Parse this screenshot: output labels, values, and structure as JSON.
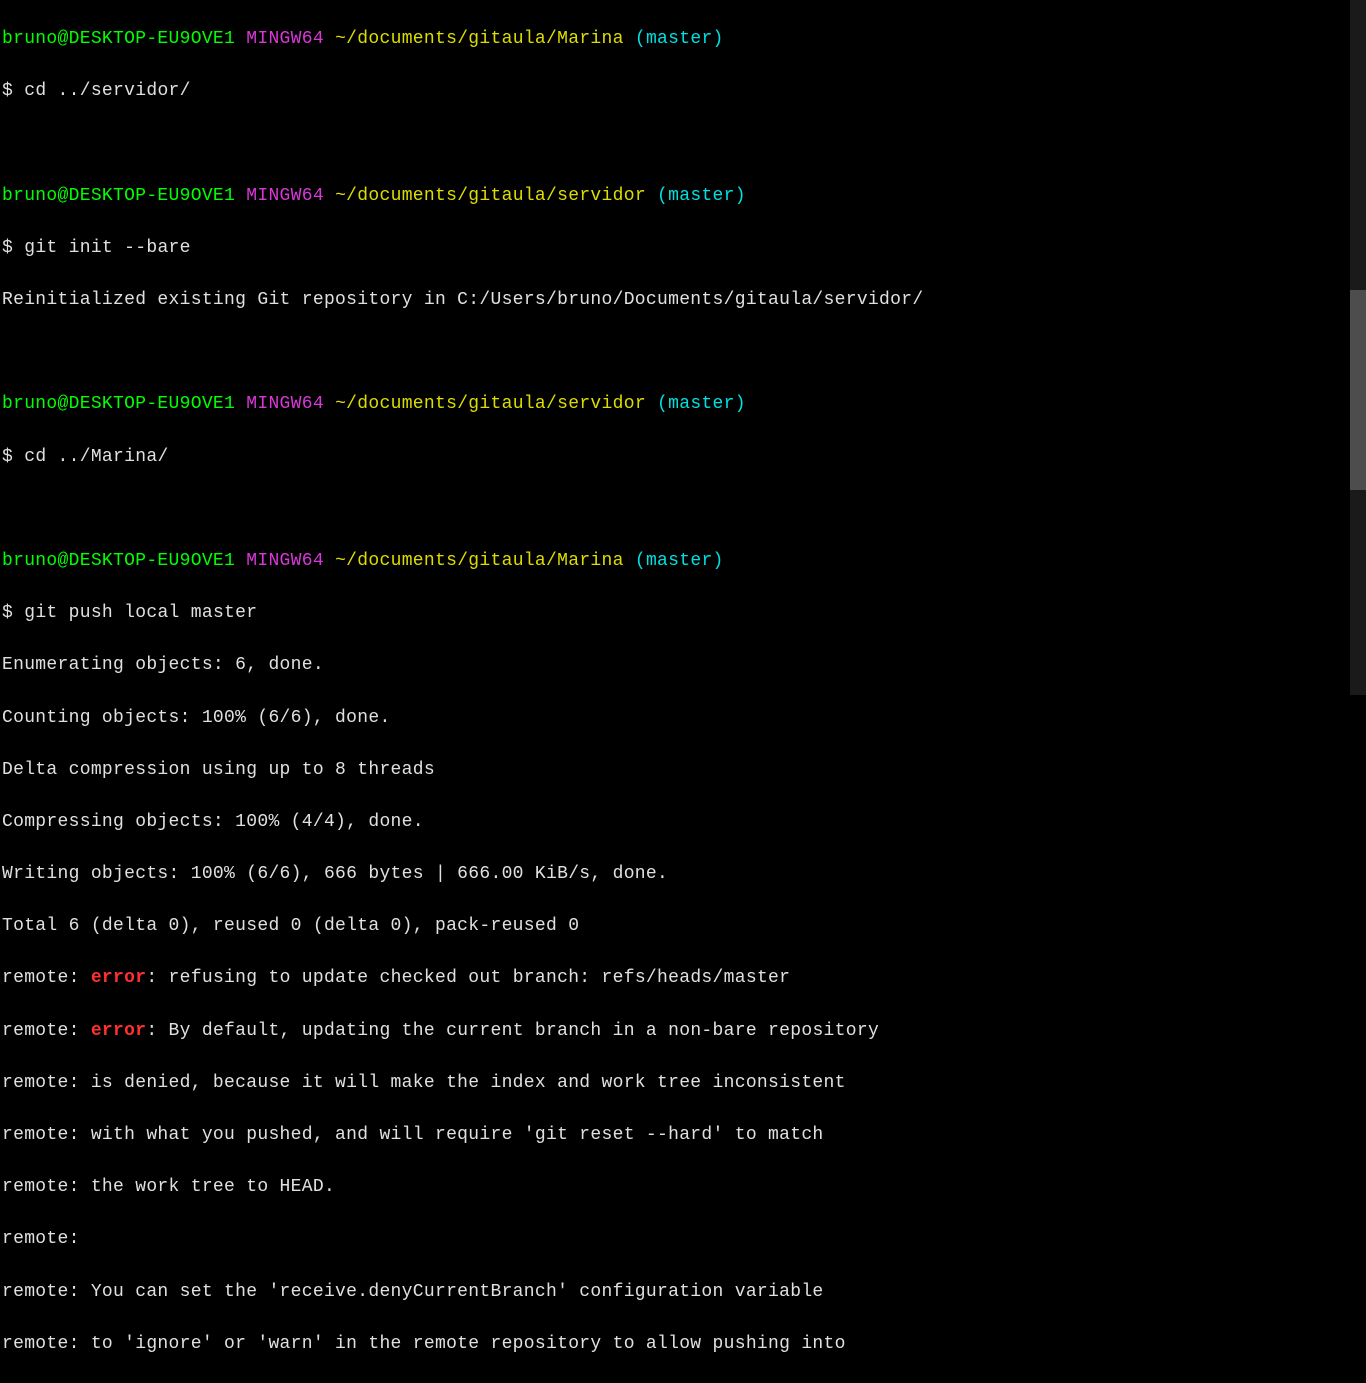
{
  "prompts": [
    {
      "user_host": "bruno@DESKTOP-EU9OVE1",
      "system": "MINGW64",
      "path": "~/documents/gitaula/Marina",
      "branch": "(master)",
      "command": "cd ../servidor/"
    },
    {
      "user_host": "bruno@DESKTOP-EU9OVE1",
      "system": "MINGW64",
      "path": "~/documents/gitaula/servidor",
      "branch": "(master)",
      "command": "git init --bare"
    },
    {
      "user_host": "bruno@DESKTOP-EU9OVE1",
      "system": "MINGW64",
      "path": "~/documents/gitaula/servidor",
      "branch": "(master)",
      "command": "cd ../Marina/"
    },
    {
      "user_host": "bruno@DESKTOP-EU9OVE1",
      "system": "MINGW64",
      "path": "~/documents/gitaula/Marina",
      "branch": "(master)",
      "command": "git push local master"
    }
  ],
  "outputs": {
    "init_result": "Reinitialized existing Git repository in C:/Users/bruno/Documents/gitaula/servidor/",
    "push": [
      "Enumerating objects: 6, done.",
      "Counting objects: 100% (6/6), done.",
      "Delta compression using up to 8 threads",
      "Compressing objects: 100% (4/4), done.",
      "Writing objects: 100% (6/6), 666 bytes | 666.00 KiB/s, done.",
      "Total 6 (delta 0), reused 0 (delta 0), pack-reused 0"
    ],
    "remote_error_prefix": "remote: ",
    "error_word": "error",
    "remote_err1_rest": ": refusing to update checked out branch: refs/heads/master",
    "remote_err2_rest": ": By default, updating the current branch in a non-bare repository",
    "remote_lines": [
      "remote: is denied, because it will make the index and work tree inconsistent",
      "remote: with what you pushed, and will require 'git reset --hard' to match",
      "remote: the work tree to HEAD.",
      "remote:",
      "remote: You can set the 'receive.denyCurrentBranch' configuration variable",
      "remote: to 'ignore' or 'warn' in the remote repository to allow pushing into"
    ]
  },
  "dollar": "$ "
}
